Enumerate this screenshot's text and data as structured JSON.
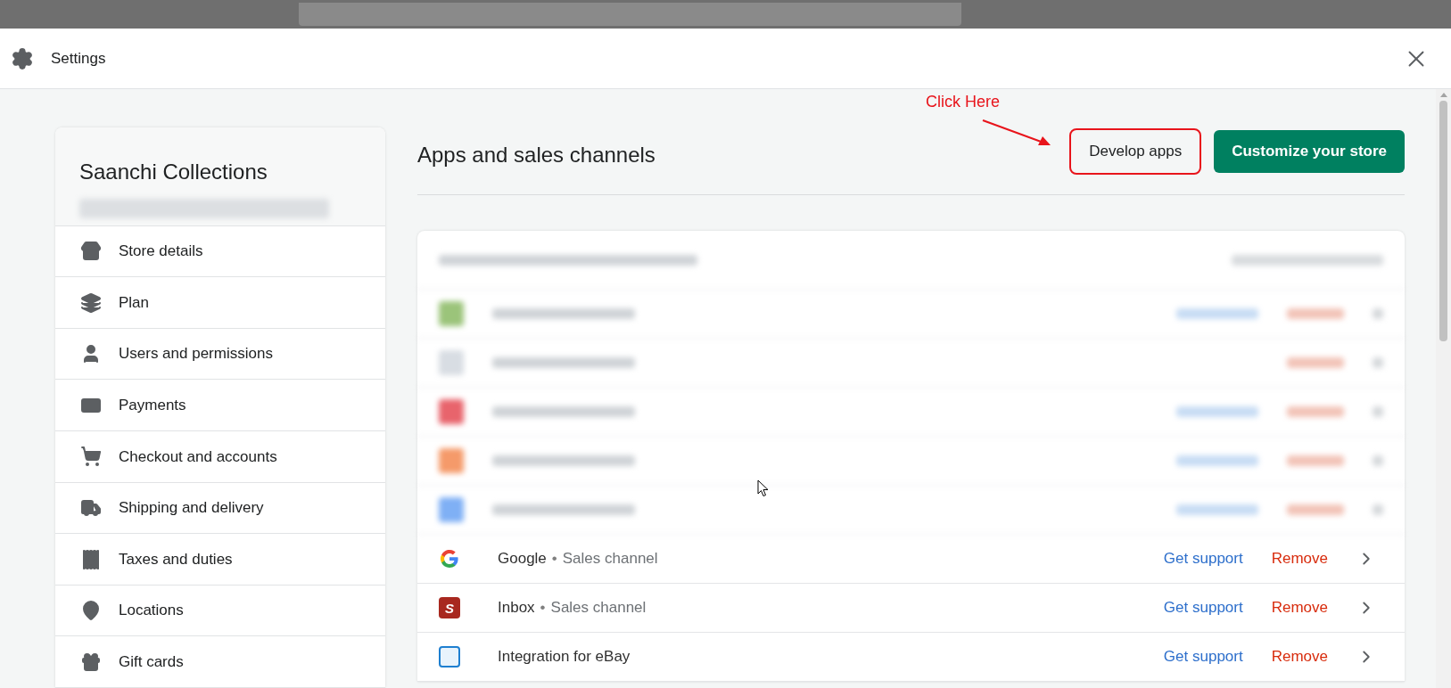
{
  "modal": {
    "title": "Settings"
  },
  "sidebar": {
    "store_name": "Saanchi Collections",
    "items": [
      {
        "label": "Store details"
      },
      {
        "label": "Plan"
      },
      {
        "label": "Users and permissions"
      },
      {
        "label": "Payments"
      },
      {
        "label": "Checkout and accounts"
      },
      {
        "label": "Shipping and delivery"
      },
      {
        "label": "Taxes and duties"
      },
      {
        "label": "Locations"
      },
      {
        "label": "Gift cards"
      }
    ]
  },
  "main": {
    "heading": "Apps and sales channels",
    "buttons": [
      {
        "label": "Develop apps",
        "kind": "secondary",
        "highlighted": true
      },
      {
        "label": "Customize your store",
        "kind": "primary",
        "highlighted": false
      }
    ],
    "annotation": {
      "text": "Click Here"
    },
    "apps": [
      {
        "kind": "blurred",
        "color": "#9bc47a",
        "support": true
      },
      {
        "kind": "blurred",
        "color": "#d8dde3",
        "support": false
      },
      {
        "kind": "blurred",
        "color": "#e8646c",
        "support": true
      },
      {
        "kind": "blurred",
        "color": "#f59a6a",
        "support": true
      },
      {
        "kind": "blurred",
        "color": "#7fb0f5",
        "support": true
      },
      {
        "kind": "google",
        "name": "Google",
        "separator": "•",
        "type": "Sales channel",
        "support_label": "Get support",
        "remove_label": "Remove"
      },
      {
        "kind": "inbox",
        "icon_letter": "S",
        "name": "Inbox",
        "separator": "•",
        "type": "Sales channel",
        "support_label": "Get support",
        "remove_label": "Remove"
      },
      {
        "kind": "ebay",
        "name": "Integration for eBay",
        "support_label": "Get support",
        "remove_label": "Remove"
      }
    ]
  }
}
